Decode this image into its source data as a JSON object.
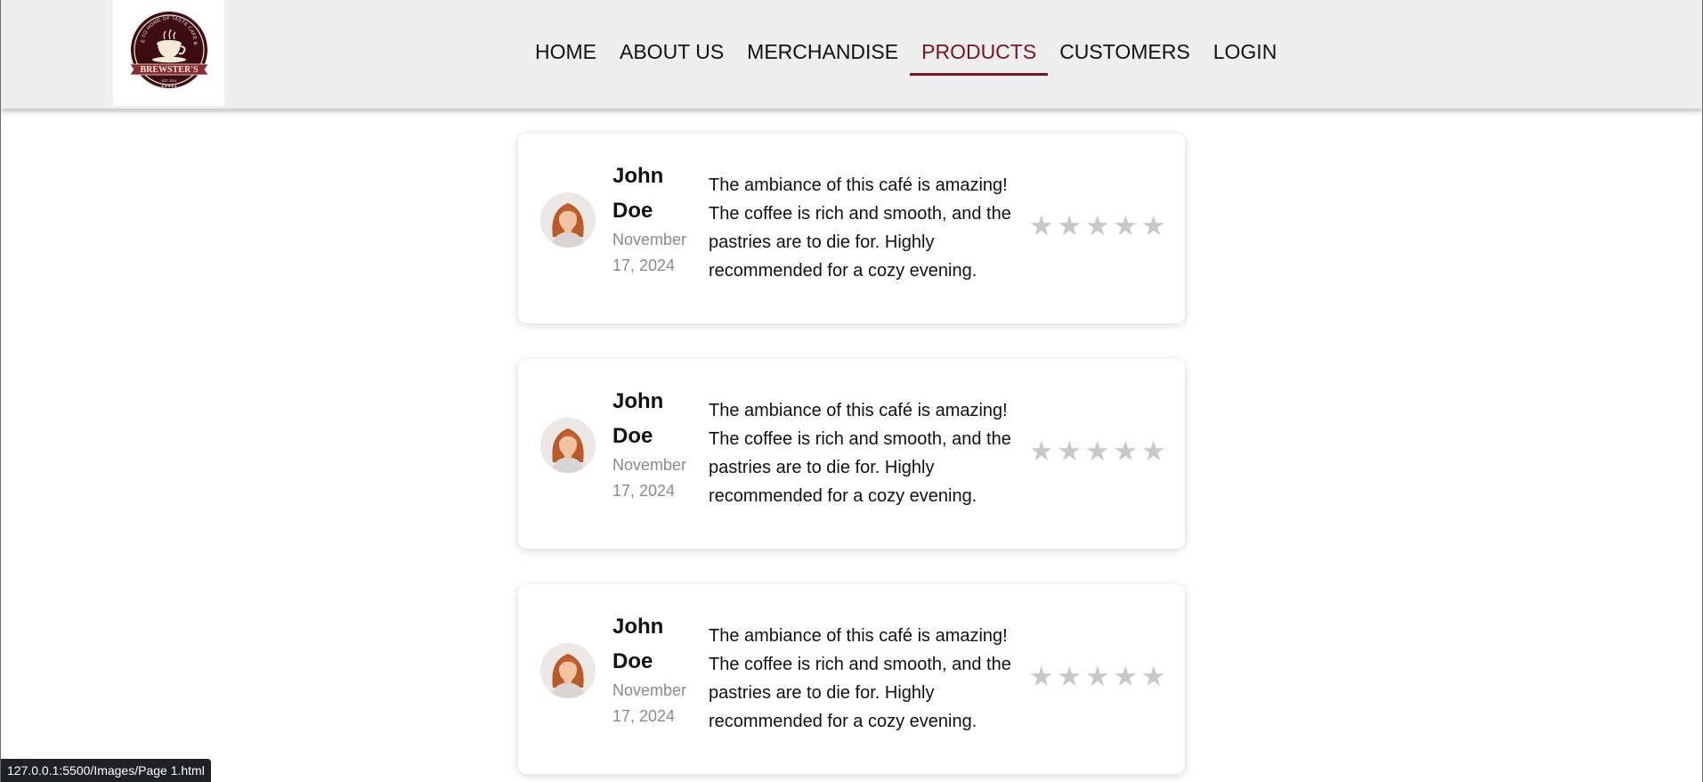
{
  "header": {
    "logo": {
      "arc_text": "WELCOME TO HOME OF TASTE CAFE & BISTRO",
      "banner_text": "BREWSTER'S",
      "est_text": "EST. 2024",
      "colors": {
        "dark": "#3d0b12",
        "banner": "#8a2a35",
        "cream": "#f3ead8"
      }
    },
    "nav": [
      {
        "label": "HOME",
        "active": false
      },
      {
        "label": "ABOUT US",
        "active": false
      },
      {
        "label": "MERCHANDISE",
        "active": false
      },
      {
        "label": "PRODUCTS",
        "active": true
      },
      {
        "label": "CUSTOMERS",
        "active": false
      },
      {
        "label": "LOGIN",
        "active": false
      }
    ],
    "accent_color": "#7a1420"
  },
  "reviews": [
    {
      "name": "John Doe",
      "date": "November 17, 2024",
      "text": "The ambiance of this café is amazing! The coffee is rich and smooth, and the pastries are to die for. Highly recommended for a cozy evening.",
      "rating": 0,
      "max_rating": 5
    },
    {
      "name": "John Doe",
      "date": "November 17, 2024",
      "text": "The ambiance of this café is amazing! The coffee is rich and smooth, and the pastries are to die for. Highly recommended for a cozy evening.",
      "rating": 0,
      "max_rating": 5
    },
    {
      "name": "John Doe",
      "date": "November 17, 2024",
      "text": "The ambiance of this café is amazing! The coffee is rich and smooth, and the pastries are to die for. Highly recommended for a cozy evening.",
      "rating": 0,
      "max_rating": 5
    }
  ],
  "star_icon": "star-icon",
  "star_color_empty": "#c8c8c8",
  "status_bar": {
    "url": "127.0.0.1:5500/Images/Page 1.html"
  }
}
